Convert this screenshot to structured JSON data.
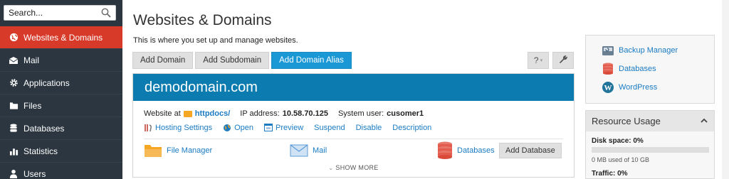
{
  "sidebar": {
    "search_placeholder": "Search...",
    "items": [
      {
        "label": "Websites & Domains",
        "icon": "globe-icon",
        "active": true
      },
      {
        "label": "Mail",
        "icon": "envelope-icon"
      },
      {
        "label": "Applications",
        "icon": "gear-icon"
      },
      {
        "label": "Files",
        "icon": "files-icon"
      },
      {
        "label": "Databases",
        "icon": "database-icon"
      },
      {
        "label": "Statistics",
        "icon": "bar-chart-icon"
      },
      {
        "label": "Users",
        "icon": "user-icon"
      }
    ]
  },
  "main": {
    "title": "Websites & Domains",
    "description": "This is where you set up and manage websites.",
    "toolbar": {
      "add_domain": "Add Domain",
      "add_subdomain": "Add Subdomain",
      "add_domain_alias": "Add Domain Alias",
      "help_label": "?"
    }
  },
  "domain": {
    "name": "demodomain.com",
    "website_at_label": "Website at",
    "website_path": "httpdocs/",
    "ip_label": "IP address:",
    "ip_value": "10.58.70.125",
    "user_label": "System user:",
    "user_value": "cusomer1",
    "actions": [
      {
        "label": "Hosting Settings",
        "icon": "tools-icon"
      },
      {
        "label": "Open",
        "icon": "globe-icon"
      },
      {
        "label": "Preview",
        "icon": "preview-icon"
      },
      {
        "label": "Suspend"
      },
      {
        "label": "Disable"
      },
      {
        "label": "Description"
      }
    ],
    "tools": {
      "file_manager": "File Manager",
      "mail": "Mail",
      "databases": "Databases",
      "add_database": "Add Database"
    },
    "show_more": "SHOW MORE"
  },
  "side_panel": {
    "links": [
      {
        "label": "Backup Manager",
        "icon": "backup-icon"
      },
      {
        "label": "Databases",
        "icon": "database-icon"
      },
      {
        "label": "WordPress",
        "icon": "wordpress-icon"
      }
    ]
  },
  "resource_usage": {
    "title": "Resource Usage",
    "disk_label": "Disk space:",
    "disk_value": "0%",
    "disk_detail": "0 MB used of 10 GB",
    "traffic_label": "Traffic:",
    "traffic_value": "0%"
  },
  "colors": {
    "sidebar_bg": "#2b3640",
    "active_item": "#d73a29",
    "primary_button": "#1a98d5",
    "domain_header": "#0b7bb0",
    "link": "#1a7bc2"
  }
}
